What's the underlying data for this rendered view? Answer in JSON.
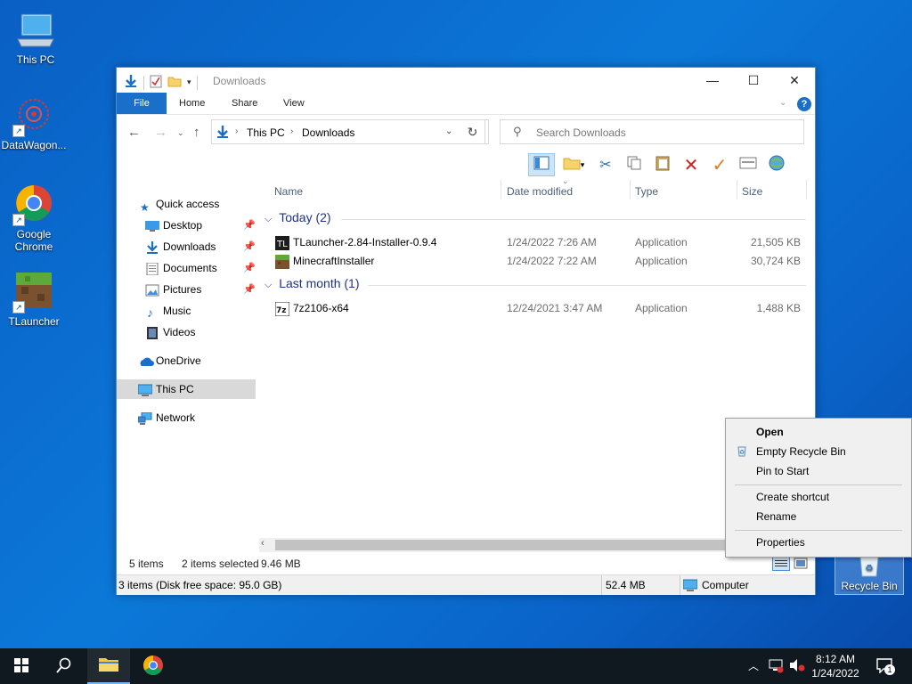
{
  "desktop": {
    "icons": [
      {
        "label": "This PC"
      },
      {
        "label": "DataWagon..."
      },
      {
        "label": "Google Chrome"
      },
      {
        "label": "TLauncher"
      },
      {
        "label": "Recycle Bin"
      }
    ]
  },
  "window": {
    "title": "Downloads",
    "controls": {
      "minimize": "—",
      "maximize": "☐",
      "close": "✕"
    },
    "ribbon_tabs": [
      "File",
      "Home",
      "Share",
      "View"
    ],
    "help": "?",
    "address": {
      "crumbs": [
        "This PC",
        "Downloads"
      ]
    },
    "search": {
      "placeholder": "Search Downloads"
    },
    "nav": {
      "items": [
        {
          "label": "Quick access",
          "pinned": false
        },
        {
          "label": "Desktop",
          "pinned": true
        },
        {
          "label": "Downloads",
          "pinned": true
        },
        {
          "label": "Documents",
          "pinned": true
        },
        {
          "label": "Pictures",
          "pinned": true
        },
        {
          "label": "Music",
          "pinned": false
        },
        {
          "label": "Videos",
          "pinned": false
        },
        {
          "label": "OneDrive",
          "pinned": false
        },
        {
          "label": "This PC",
          "pinned": false,
          "selected": true
        },
        {
          "label": "Network",
          "pinned": false
        }
      ]
    },
    "columns": [
      "Name",
      "Date modified",
      "Type",
      "Size"
    ],
    "groups": [
      {
        "label": "Today (2)",
        "files": [
          {
            "name": "TLauncher-2.84-Installer-0.9.4",
            "date": "1/24/2022 7:26 AM",
            "type": "Application",
            "size": "21,505 KB"
          },
          {
            "name": "MinecraftInstaller",
            "date": "1/24/2022 7:22 AM",
            "type": "Application",
            "size": "30,724 KB"
          }
        ]
      },
      {
        "label": "Last month (1)",
        "files": [
          {
            "name": "7z2106-x64",
            "date": "12/24/2021 3:47 AM",
            "type": "Application",
            "size": "1,488 KB"
          }
        ]
      }
    ],
    "status": {
      "count": "5 items",
      "selected": "2 items selected",
      "size": "9.46 MB"
    },
    "bottom": {
      "left": "3 items (Disk free space: 95.0 GB)",
      "size": "52.4 MB",
      "location": "Computer"
    }
  },
  "context_menu": {
    "items": [
      "Open",
      "Empty Recycle Bin",
      "Pin to Start",
      "Create shortcut",
      "Rename",
      "Properties"
    ]
  },
  "taskbar": {
    "time": "8:12 AM",
    "date": "1/24/2022",
    "notification_count": "1"
  },
  "colors": {
    "accent": "#1a6fc9",
    "desktop": "#0b78d8",
    "taskbar": "#101820"
  }
}
